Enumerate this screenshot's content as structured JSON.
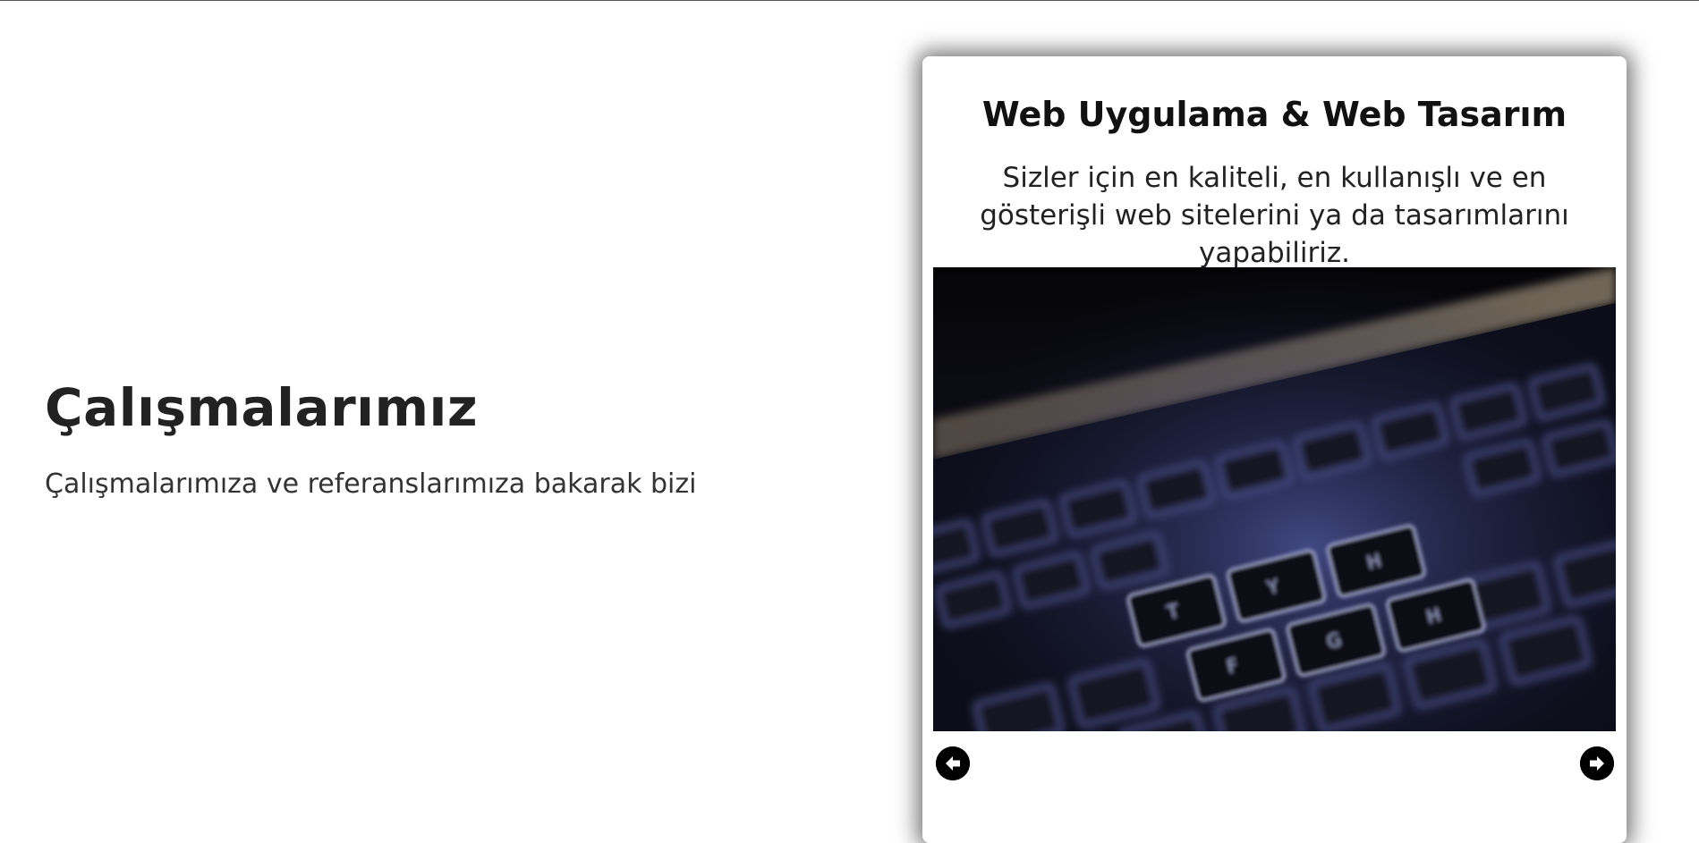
{
  "intro": {
    "heading": "Çalışmalarımız",
    "text": "Çalışmalarımıza ve referanslarımıza bakarak bizi"
  },
  "card": {
    "title": "Web Uygulama & Web Tasarım",
    "description": "Sizler için en kaliteli, en kullanışlı ve en gösterişli web sitelerini ya da tasarımlarını yapabiliriz.",
    "image_label": "keyboard-photo",
    "prev_icon": "arrow-left-circle-icon",
    "next_icon": "arrow-right-circle-icon"
  },
  "colors": {
    "heading": "#222222",
    "text": "#333333",
    "card_bg": "#ffffff",
    "nav_button": "#000000"
  }
}
